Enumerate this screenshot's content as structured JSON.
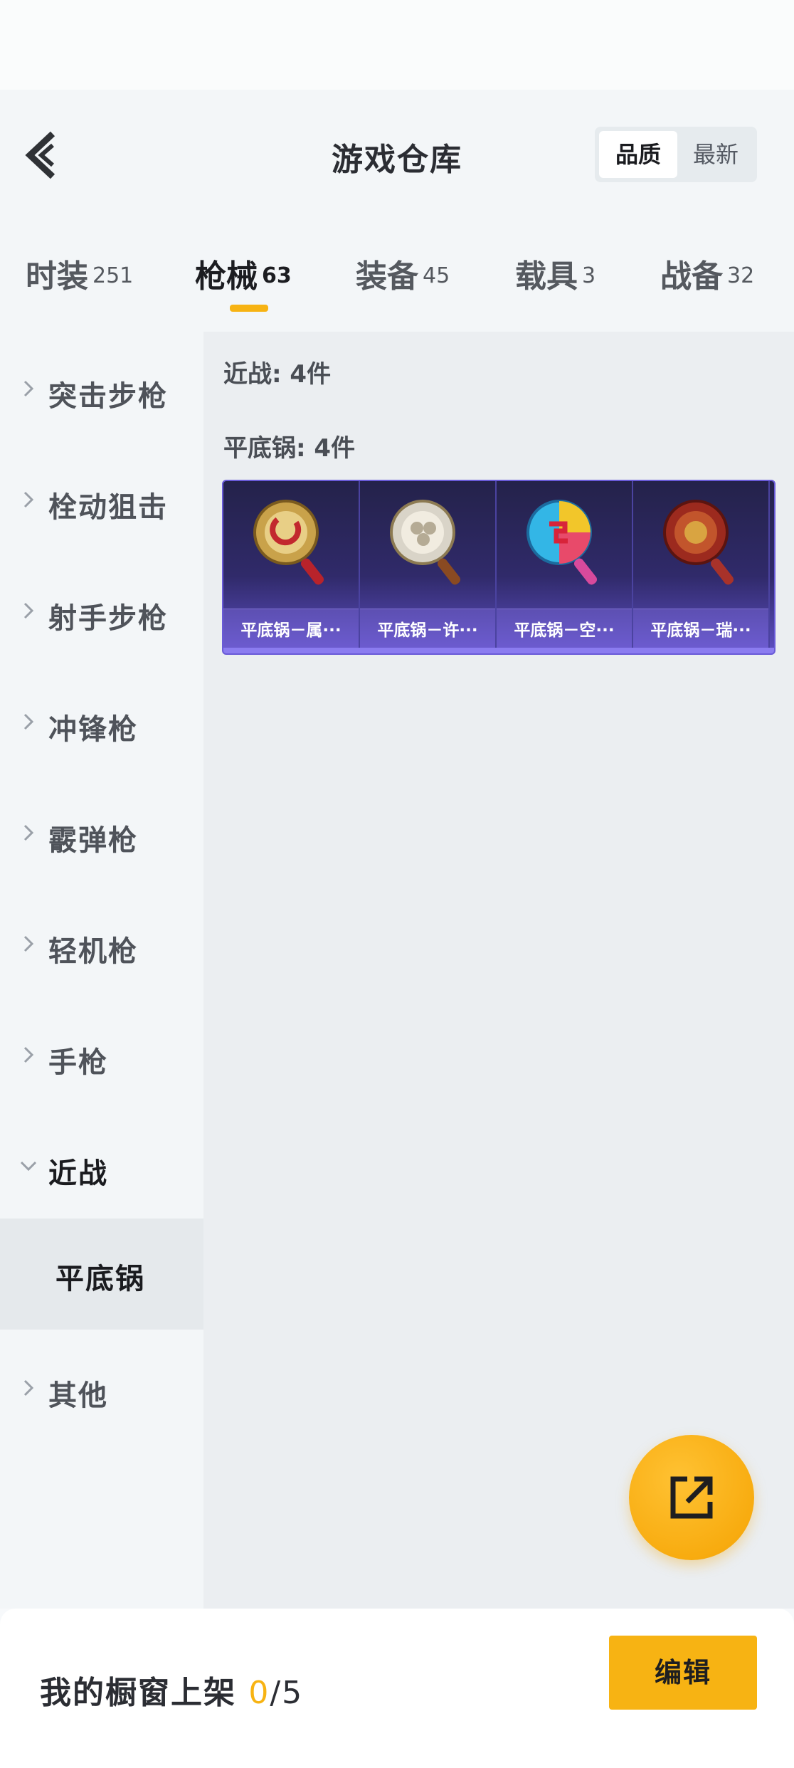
{
  "header": {
    "title": "游戏仓库",
    "sort": {
      "active": "品质",
      "other": "最新"
    }
  },
  "tabs": [
    {
      "label": "时装",
      "count": "251"
    },
    {
      "label": "枪械",
      "count": "63"
    },
    {
      "label": "装备",
      "count": "45"
    },
    {
      "label": "载具",
      "count": "3"
    },
    {
      "label": "战备",
      "count": "32"
    }
  ],
  "sidebar": {
    "items": [
      "突击步枪",
      "栓动狙击",
      "射手步枪",
      "冲锋枪",
      "霰弹枪",
      "轻机枪",
      "手枪",
      "近战",
      "其他"
    ],
    "sub_selected": "平底锅"
  },
  "content": {
    "section_heading": "近战: 4件",
    "sub_heading": "平底锅: 4件",
    "items": [
      {
        "name": "平底锅－属···"
      },
      {
        "name": "平底锅－许···"
      },
      {
        "name": "平底锅－空···"
      },
      {
        "name": "平底锅－瑞···"
      }
    ]
  },
  "footer": {
    "label": "我的橱窗上架",
    "current": "0",
    "total": "/5",
    "edit_label": "编辑"
  },
  "colors": {
    "accent": "#f7b313",
    "card_bg": "#2e2a66"
  }
}
